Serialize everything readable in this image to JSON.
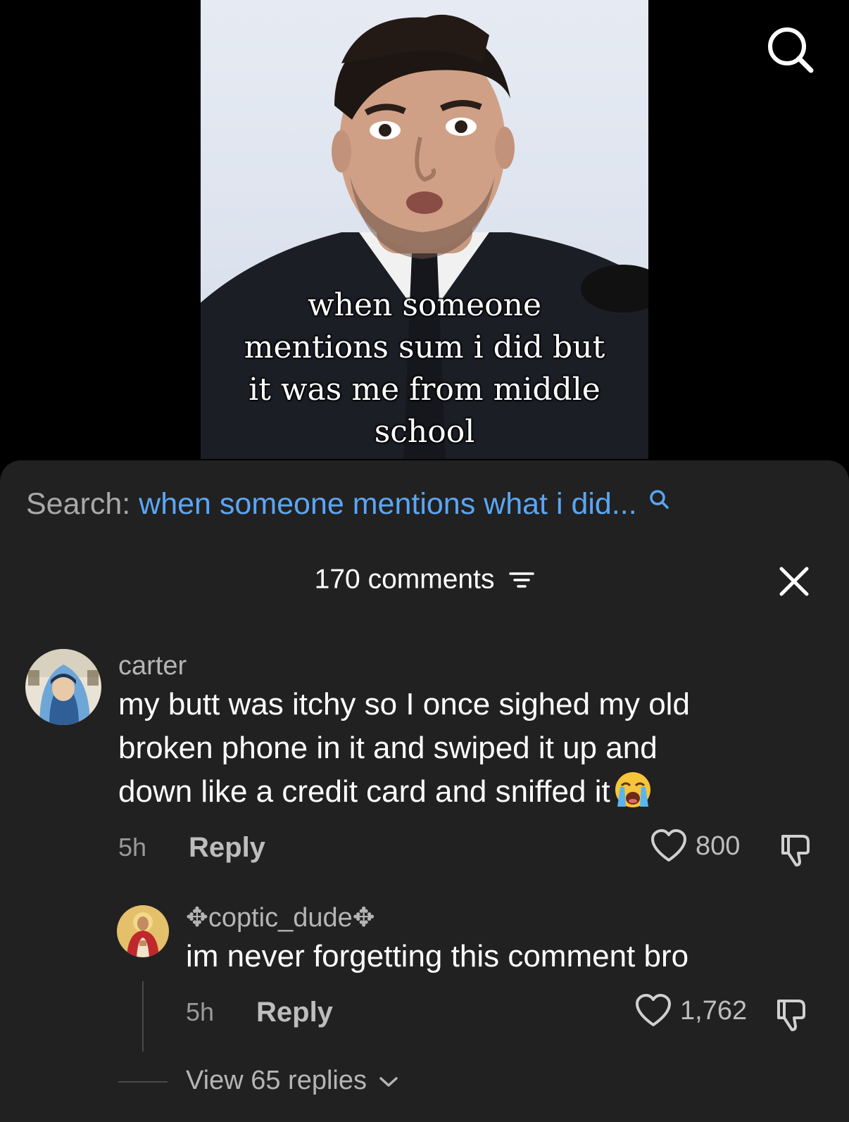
{
  "video": {
    "caption": "when someone\nmentions sum i did but\nit was me from middle\nschool",
    "search_icon": "search-icon"
  },
  "search_suggestion": {
    "prefix": "Search:",
    "query": "when someone mentions what i did...",
    "icon": "search-icon"
  },
  "comments_header": {
    "count_label": "170 comments",
    "filter_icon": "filter-icon",
    "close_icon": "close-icon"
  },
  "comment": {
    "username": "carter",
    "text": "my butt was itchy so I once sighed my old\nbroken phone in it and swiped it up and\ndown like a credit card and sniffed it",
    "emoji": "loudly-crying-face",
    "time": "5h",
    "reply_label": "Reply",
    "likes": "800"
  },
  "reply": {
    "username": "✥coptic_dude✥",
    "text": "im never forgetting this comment bro",
    "time": "5h",
    "reply_label": "Reply",
    "likes": "1,762"
  },
  "view_replies_label": "View 65 replies",
  "colors": {
    "sheet_bg": "#212121",
    "link_blue": "#5aa6f5",
    "muted_text": "#b5b5b5"
  }
}
